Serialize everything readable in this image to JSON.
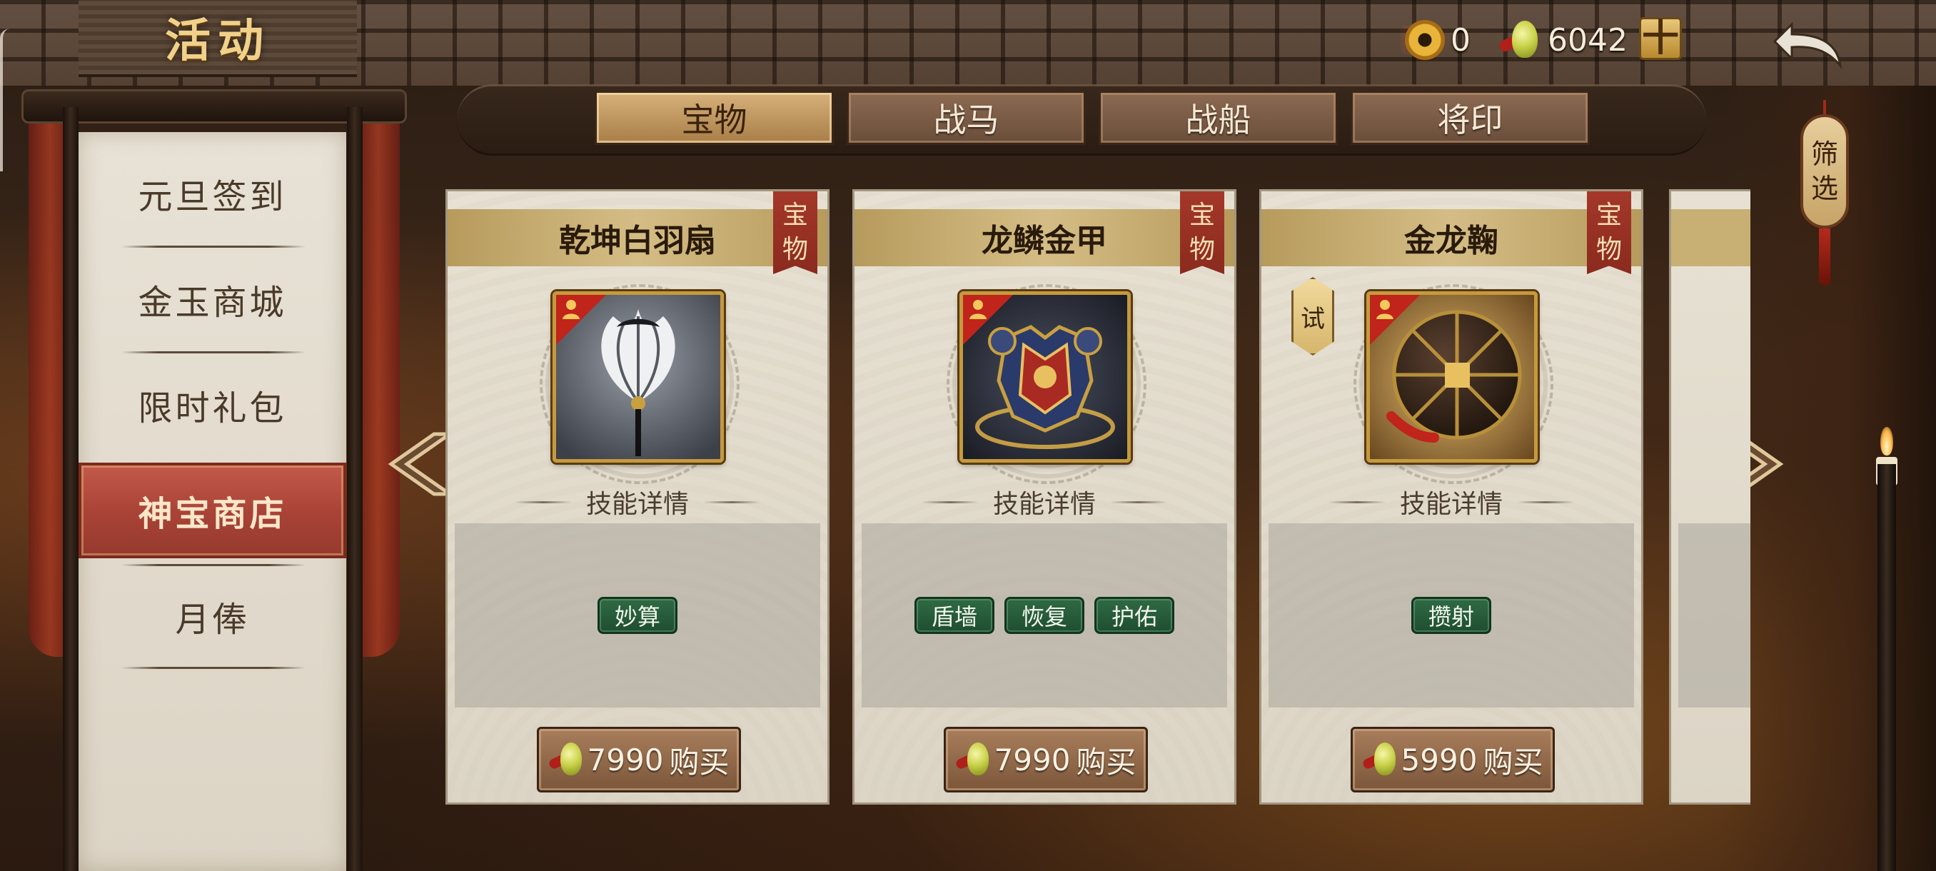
{
  "header": {
    "title": "活动",
    "copper_count": "0",
    "jade_count": "6042",
    "plus_label": "十"
  },
  "sidebar": {
    "items": [
      {
        "label": "元旦签到",
        "active": false
      },
      {
        "label": "金玉商城",
        "active": false
      },
      {
        "label": "限时礼包",
        "active": false
      },
      {
        "label": "神宝商店",
        "active": true
      },
      {
        "label": "月俸",
        "active": false
      }
    ]
  },
  "tabs": [
    {
      "label": "宝物",
      "active": true
    },
    {
      "label": "战马",
      "active": false
    },
    {
      "label": "战船",
      "active": false
    },
    {
      "label": "将印",
      "active": false
    }
  ],
  "filter_label": [
    "筛",
    "选"
  ],
  "cards": [
    {
      "name": "乾坤白羽扇",
      "type": [
        "宝",
        "物"
      ],
      "trial": null,
      "skill_detail": "技能详情",
      "skills": [
        "妙算"
      ],
      "price": "7990",
      "buy_label": "购买",
      "icon": "feather-fan-icon"
    },
    {
      "name": "龙鳞金甲",
      "type": [
        "宝",
        "物"
      ],
      "trial": null,
      "skill_detail": "技能详情",
      "skills": [
        "盾墙",
        "恢复",
        "护佑"
      ],
      "price": "7990",
      "buy_label": "购买",
      "icon": "armor-icon"
    },
    {
      "name": "金龙鞠",
      "type": [
        "宝",
        "物"
      ],
      "trial": "试",
      "skill_detail": "技能详情",
      "skills": [
        "攒射"
      ],
      "price": "5990",
      "buy_label": "购买",
      "icon": "cuju-ball-icon"
    }
  ],
  "colors": {
    "gold_text": "#f1d08a",
    "active_menu": "#a84236",
    "skill_tag": "#2f6a44",
    "ribbon": "#a4382a"
  }
}
